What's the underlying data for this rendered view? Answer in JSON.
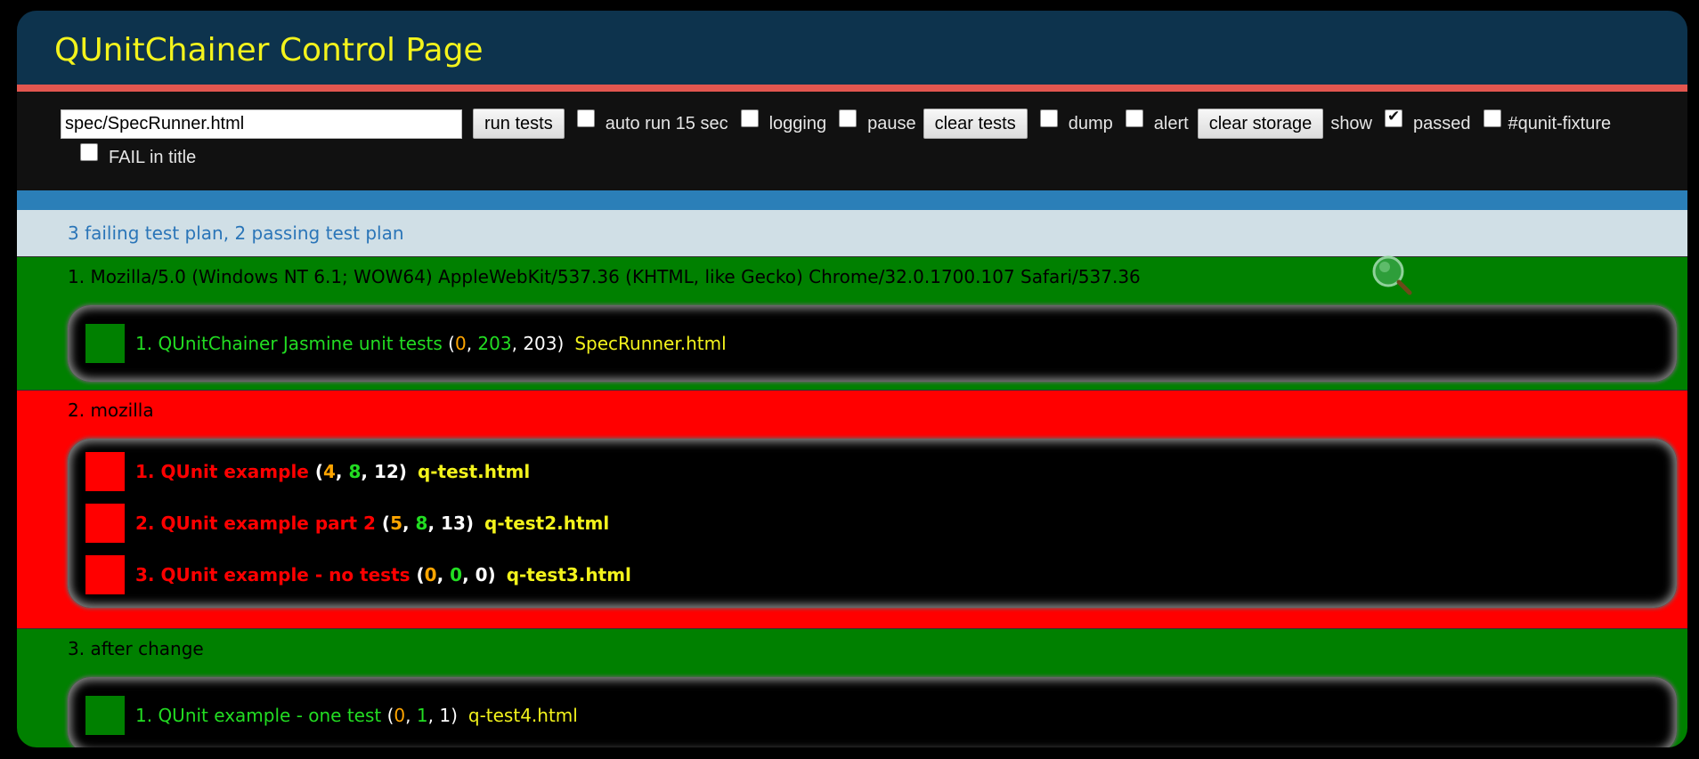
{
  "header": {
    "title": "QUnitChainer Control Page"
  },
  "toolbar": {
    "url_value": "spec/SpecRunner.html",
    "run_tests_label": "run tests",
    "auto_run_label": "auto run 15 sec",
    "logging_label": "logging",
    "pause_label": "pause",
    "clear_tests_label": "clear tests",
    "dump_label": "dump",
    "alert_label": "alert",
    "clear_storage_label": "clear storage",
    "show_label": "show",
    "passed_label": "passed",
    "passed_checked": true,
    "qunit_fixture_label": "#qunit-fixture",
    "fail_in_title_label": "FAIL in title"
  },
  "summary": {
    "text": "3 failing test plan, 2 passing test plan"
  },
  "plans": [
    {
      "title": "1. Mozilla/5.0 (Windows NT 6.1; WOW64) AppleWebKit/537.36 (KHTML, like Gecko) Chrome/32.0.1700.107 Safari/537.36",
      "status": "pass",
      "suites": [
        {
          "name": "1. QUnitChainer Jasmine unit tests",
          "failed": "0",
          "passed": "203",
          "total": "203",
          "file": "SpecRunner.html"
        }
      ]
    },
    {
      "title": "2. mozilla",
      "status": "fail",
      "suites": [
        {
          "name": "1. QUnit example",
          "failed": "4",
          "passed": "8",
          "total": "12",
          "file": "q-test.html"
        },
        {
          "name": "2. QUnit example part 2",
          "failed": "5",
          "passed": "8",
          "total": "13",
          "file": "q-test2.html"
        },
        {
          "name": "3. QUnit example - no tests",
          "failed": "0",
          "passed": "0",
          "total": "0",
          "file": "q-test3.html"
        }
      ]
    },
    {
      "title": "3. after change",
      "status": "pass",
      "suites": [
        {
          "name": "1. QUnit example - one test",
          "failed": "0",
          "passed": "1",
          "total": "1",
          "file": "q-test4.html"
        }
      ]
    }
  ],
  "colors": {
    "header_bg": "#0d334d",
    "title_yellow": "#f3f31c",
    "header_border": "#e2564f",
    "pass_bg": "#008000",
    "fail_bg": "#ff0000",
    "pass_text": "#22dd22",
    "fail_text": "#ff0000",
    "failed_count": "#ffa500",
    "summary_bg": "#d0dfe6",
    "summary_text": "#2a75b8"
  },
  "icons": {
    "magnifier": "magnifier-icon"
  }
}
